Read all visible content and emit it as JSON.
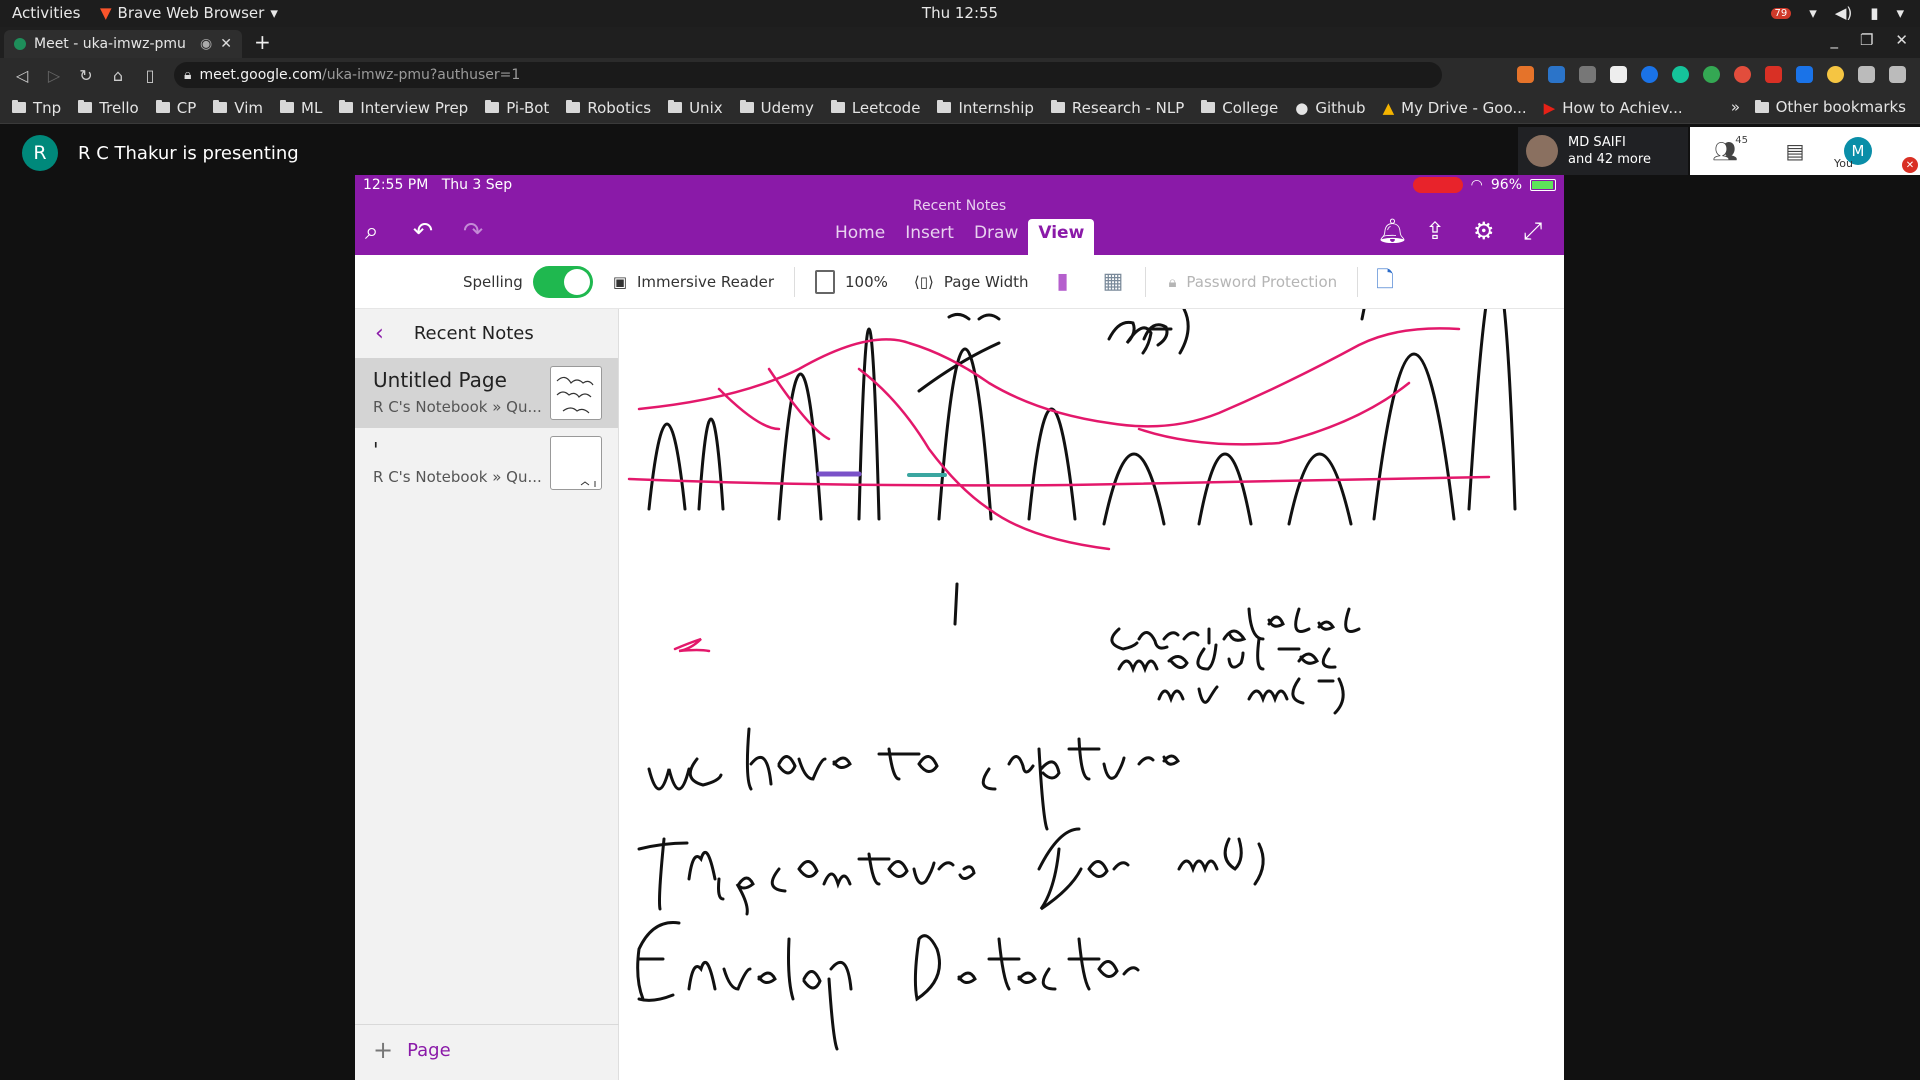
{
  "system": {
    "activities": "Activities",
    "app_name": "Brave Web Browser",
    "clock": "Thu 12:55",
    "notif_count": "79"
  },
  "browser": {
    "tab_title": "Meet - uka-imwz-pmu",
    "url_host": "meet.google.com",
    "url_path": "/uka-imwz-pmu?authuser=1",
    "bookmarks": [
      "Tnp",
      "Trello",
      "CP",
      "Vim",
      "ML",
      "Interview Prep",
      "Pi-Bot",
      "Robotics",
      "Unix",
      "Udemy",
      "Leetcode",
      "Internship",
      "Research - NLP",
      "College",
      "Github",
      "My Drive - Goo...",
      "How to Achiev..."
    ],
    "more": "»",
    "other_bookmarks": "Other bookmarks"
  },
  "meet": {
    "presenter_initial": "R",
    "presenter_text": "R C Thakur is presenting",
    "participant_name": "MD SAIFI",
    "participant_more": "and 42 more",
    "people_count": "45",
    "you_label": "You",
    "you_initial": "M"
  },
  "ipad": {
    "time": "12:55 PM",
    "date": "Thu 3 Sep",
    "battery": "96%",
    "header_title": "Recent Notes",
    "tabs": [
      "Home",
      "Insert",
      "Draw",
      "View"
    ],
    "active_tab": "View",
    "viewbar": {
      "spelling": "Spelling",
      "immersive": "Immersive Reader",
      "zoom": "100%",
      "page_width": "Page Width",
      "password": "Password Protection"
    },
    "sidebar": {
      "title": "Recent Notes",
      "notes": [
        {
          "title": "Untitled Page",
          "path": "R C's Notebook » Qu..."
        },
        {
          "title": "'",
          "path": "R C's Notebook » Qu..."
        }
      ],
      "add_page": "Page"
    }
  },
  "colors": {
    "onenote_purple": "#8a1aa8",
    "ink_pink": "#e3186b",
    "toggle_green": "#1fb84f"
  }
}
